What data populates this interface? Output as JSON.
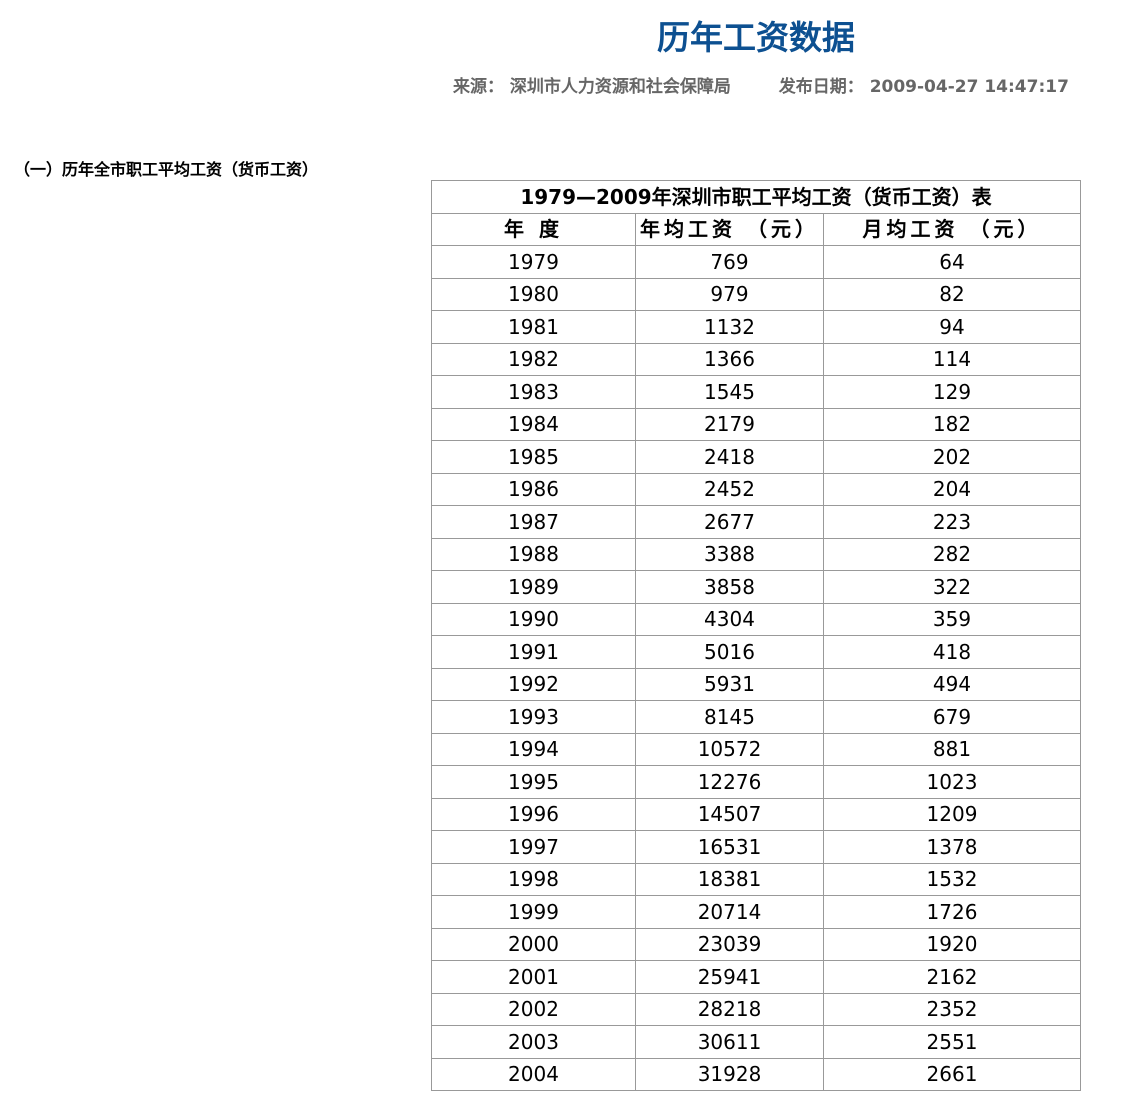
{
  "page": {
    "title": "历年工资数据",
    "source_label": "来源：",
    "source_value": "深圳市人力资源和社会保障局",
    "date_label": "发布日期：",
    "date_value": "2009-04-27 14:47:17"
  },
  "section": {
    "heading": "（一）历年全市职工平均工资（货币工资）"
  },
  "table": {
    "caption": "1979—2009年深圳市职工平均工资（货币工资）表",
    "headers": [
      "年 度",
      "年均工资 （元）",
      "月均工资 （元）"
    ],
    "rows": [
      [
        "1979",
        "769",
        "64"
      ],
      [
        "1980",
        "979",
        "82"
      ],
      [
        "1981",
        "1132",
        "94"
      ],
      [
        "1982",
        "1366",
        "114"
      ],
      [
        "1983",
        "1545",
        "129"
      ],
      [
        "1984",
        "2179",
        "182"
      ],
      [
        "1985",
        "2418",
        "202"
      ],
      [
        "1986",
        "2452",
        "204"
      ],
      [
        "1987",
        "2677",
        "223"
      ],
      [
        "1988",
        "3388",
        "282"
      ],
      [
        "1989",
        "3858",
        "322"
      ],
      [
        "1990",
        "4304",
        "359"
      ],
      [
        "1991",
        "5016",
        "418"
      ],
      [
        "1992",
        "5931",
        "494"
      ],
      [
        "1993",
        "8145",
        "679"
      ],
      [
        "1994",
        "10572",
        "881"
      ],
      [
        "1995",
        "12276",
        "1023"
      ],
      [
        "1996",
        "14507",
        "1209"
      ],
      [
        "1997",
        "16531",
        "1378"
      ],
      [
        "1998",
        "18381",
        "1532"
      ],
      [
        "1999",
        "20714",
        "1726"
      ],
      [
        "2000",
        "23039",
        "1920"
      ],
      [
        "2001",
        "25941",
        "2162"
      ],
      [
        "2002",
        "28218",
        "2352"
      ],
      [
        "2003",
        "30611",
        "2551"
      ],
      [
        "2004",
        "31928",
        "2661"
      ]
    ]
  },
  "colors": {
    "title": "#0d5091",
    "meta": "#666666",
    "border": "#999999"
  }
}
